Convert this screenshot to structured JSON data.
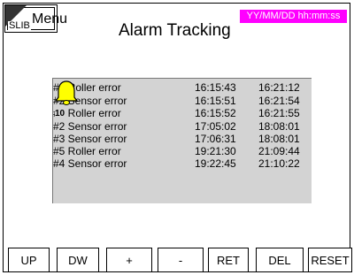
{
  "menu": {
    "label": "Menu",
    "badge": "SLIB"
  },
  "header": {
    "title": "Alarm Tracking",
    "datetime": "YY/MM/DD  hh:mm:ss",
    "datetime_color": "#ff00ff"
  },
  "alarms": {
    "panel_color": "#d3d3d3",
    "bell_icon": "bell-icon",
    "count": "10",
    "rows": [
      {
        "name": "#1 Roller error",
        "start": "16:15:43",
        "end": "16:21:12"
      },
      {
        "name": "#2 Sensor error",
        "start": "16:15:51",
        "end": "16:21:54"
      },
      {
        "name": "#1 Roller error",
        "start": "16:15:52",
        "end": "16:21:55"
      },
      {
        "name": "#2 Sensor error",
        "start": "17:05:02",
        "end": "18:08:01"
      },
      {
        "name": "#3 Sensor error",
        "start": "17:06:31",
        "end": "18:08:01"
      },
      {
        "name": "#5 Roller error",
        "start": "19:21:30",
        "end": "21:09:44"
      },
      {
        "name": "#4 Sensor error",
        "start": "19:22:45",
        "end": "21:10:22"
      }
    ]
  },
  "buttons": {
    "up": "UP",
    "down": "DW",
    "plus": "+",
    "minus": "-",
    "ret": "RET",
    "del": "DEL",
    "reset": "RESET"
  }
}
